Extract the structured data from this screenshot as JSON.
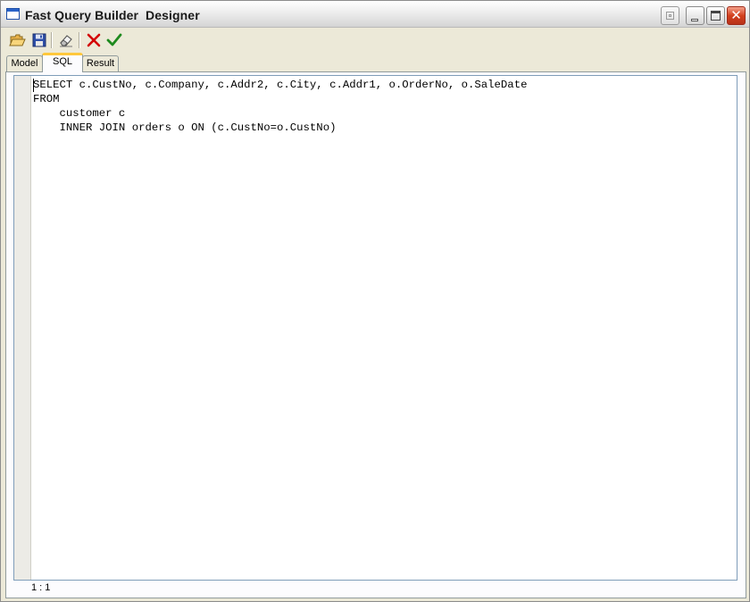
{
  "window": {
    "title": "Fast Query Builder  Designer"
  },
  "toolbar": {
    "buttons": [
      {
        "name": "open",
        "icon": "folder-open-icon"
      },
      {
        "name": "save",
        "icon": "floppy-disk-icon"
      },
      {
        "name": "clear",
        "icon": "eraser-icon"
      },
      {
        "name": "cancel",
        "icon": "red-x-icon"
      },
      {
        "name": "ok",
        "icon": "green-check-icon"
      }
    ]
  },
  "tabs": {
    "model": "Model",
    "sql": "SQL",
    "result": "Result",
    "active": "SQL"
  },
  "editor": {
    "lines": [
      "SELECT c.CustNo, c.Company, c.Addr2, c.City, c.Addr1, o.OrderNo, o.SaleDate",
      "FROM",
      "    customer c",
      "    INNER JOIN orders o ON (c.CustNo=o.CustNo)"
    ]
  },
  "status": {
    "cursor_position": "1 : 1"
  },
  "colors": {
    "accent_tab": "#FFC83C",
    "close_button": "#D2401D",
    "cancel_icon": "#D40000",
    "ok_icon": "#1E8A1E"
  }
}
